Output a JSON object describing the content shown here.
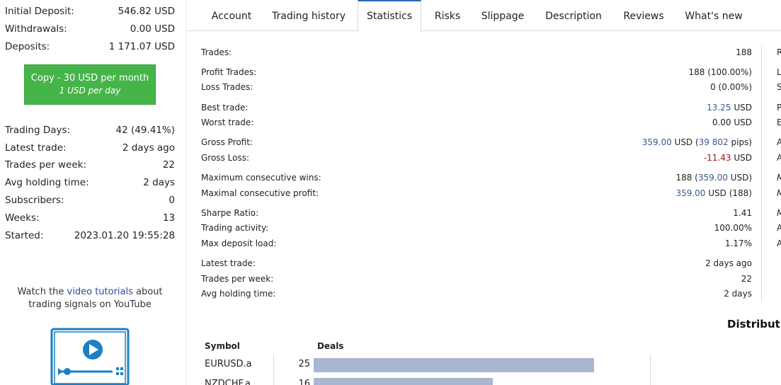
{
  "sidebar": {
    "initial_deposit": {
      "label": "Initial Deposit:",
      "value": "546.82 USD"
    },
    "withdrawals": {
      "label": "Withdrawals:",
      "value": "0.00 USD"
    },
    "deposits": {
      "label": "Deposits:",
      "value": "1 171.07 USD"
    },
    "copy_button": {
      "line1": "Copy - 30 USD per month",
      "line2": "1 USD per day"
    },
    "trading_days": {
      "label": "Trading Days:",
      "value": "42 (49.41%)"
    },
    "latest_trade": {
      "label": "Latest trade:",
      "value": "2 days ago"
    },
    "trades_per_week": {
      "label": "Trades per week:",
      "value": "22"
    },
    "avg_holding_time": {
      "label": "Avg holding time:",
      "value": "2 days"
    },
    "subscribers": {
      "label": "Subscribers:",
      "value": "0"
    },
    "weeks": {
      "label": "Weeks:",
      "value": "13"
    },
    "started": {
      "label": "Started:",
      "value": "2023.01.20 19:55:28"
    },
    "tutorial": {
      "before": "Watch the ",
      "link": "video tutorials",
      "after": " about trading signals on YouTube"
    },
    "video_icon": "video-play-icon"
  },
  "tabs": [
    "Account",
    "Trading history",
    "Statistics",
    "Risks",
    "Slippage",
    "Description",
    "Reviews",
    "What's new"
  ],
  "active_tab": "Statistics",
  "stats": {
    "trades": {
      "label": "Trades:",
      "value": "188"
    },
    "profit_trades": {
      "label": "Profit Trades:",
      "value": "188 (100.00%)"
    },
    "loss_trades": {
      "label": "Loss Trades:",
      "value": "0 (0.00%)"
    },
    "best_trade": {
      "label": "Best trade:",
      "value": "13.25",
      "unit": " USD"
    },
    "worst_trade": {
      "label": "Worst trade:",
      "value": "0.00 USD"
    },
    "gross_profit": {
      "label": "Gross Profit:",
      "v1": "359.00",
      "v2": " USD (",
      "v3": "39 802",
      "v4": " pips)"
    },
    "gross_loss": {
      "label": "Gross Loss:",
      "value": "-11.43",
      "unit": " USD"
    },
    "max_consec_wins": {
      "label": "Maximum consecutive wins:",
      "v1": "188 (",
      "v2": "359.00",
      "v3": " USD)"
    },
    "max_consec_profit": {
      "label": "Maximal consecutive profit:",
      "v1": "359.00",
      "v2": " USD (188)"
    },
    "sharpe": {
      "label": "Sharpe Ratio:",
      "value": "1.41"
    },
    "trading_activity": {
      "label": "Trading activity:",
      "value": "100.00%"
    },
    "max_deposit_load": {
      "label": "Max deposit load:",
      "value": "1.17%"
    },
    "latest_trade": {
      "label": "Latest trade:",
      "value": "2 days ago"
    },
    "trades_per_week": {
      "label": "Trades per week:",
      "value": "22"
    },
    "avg_holding_time": {
      "label": "Avg holding time:",
      "value": "2 days"
    }
  },
  "right_col_letters": [
    "R",
    "L",
    "S",
    "P",
    "E",
    "A",
    "A",
    "M",
    "M",
    "M",
    "A",
    "A"
  ],
  "distribution": {
    "title": "Distributi",
    "headers": {
      "symbol": "Symbol",
      "deals": "Deals"
    },
    "rows": [
      {
        "symbol": "EURUSD.a",
        "deals": 25
      },
      {
        "symbol": "NZDCHF.a",
        "deals": 16
      }
    ],
    "max_deals": 25
  }
}
